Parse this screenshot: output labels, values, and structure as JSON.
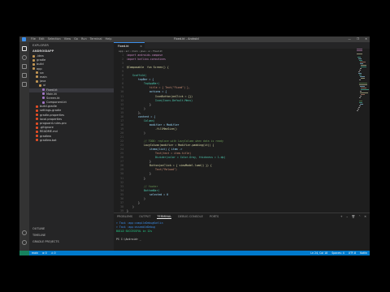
{
  "app": {
    "title": "Fixed.kt - Android",
    "menu": [
      "File",
      "Edit",
      "Selection",
      "View",
      "Go",
      "Run",
      "Terminal",
      "Help"
    ],
    "window_buttons": [
      "—",
      "❐",
      "✕"
    ]
  },
  "activity_bar": [
    "files-icon",
    "search-icon",
    "source-control-icon",
    "run-debug-icon",
    "extensions-icon",
    "account-icon",
    "settings-icon"
  ],
  "sidebar": {
    "header": "EXPLORER",
    "root": "ANDROIDAPP",
    "items": [
      {
        "label": ".idea",
        "color": "#c09553",
        "indent": 0
      },
      {
        "label": "gradle",
        "color": "#c09553",
        "indent": 0
      },
      {
        "label": "build",
        "color": "#c09553",
        "indent": 0
      },
      {
        "label": "app",
        "color": "#c09553",
        "indent": 0
      },
      {
        "label": "src",
        "color": "#c09553",
        "indent": 1
      },
      {
        "label": "main",
        "color": "#c09553",
        "indent": 1
      },
      {
        "label": "java",
        "color": "#c09553",
        "indent": 1
      },
      {
        "label": "ui",
        "color": "#c09553",
        "indent": 2
      },
      {
        "label": "Fixed.kt",
        "color": "#a074c4",
        "indent": 3,
        "selected": true
      },
      {
        "label": "Main.kt",
        "color": "#a074c4",
        "indent": 3
      },
      {
        "label": "Screen.kt",
        "color": "#a074c4",
        "indent": 3
      },
      {
        "label": "Component.kt",
        "color": "#a074c4",
        "indent": 3
      },
      {
        "label": "build.gradle",
        "color": "#e44d26",
        "indent": 1
      },
      {
        "label": "settings.gradle",
        "color": "#e44d26",
        "indent": 1
      },
      {
        "label": "gradle.properties",
        "color": "#e44d26",
        "indent": 1
      },
      {
        "label": "local.properties",
        "color": "#e44d26",
        "indent": 1
      },
      {
        "label": "proguard-rules.pro",
        "color": "#e44d26",
        "indent": 1
      },
      {
        "label": ".gitignore",
        "color": "#e44d26",
        "indent": 1
      },
      {
        "label": "README.md",
        "color": "#e44d26",
        "indent": 1
      },
      {
        "label": "gradlew",
        "color": "#e44d26",
        "indent": 1
      },
      {
        "label": "gradlew.bat",
        "color": "#e44d26",
        "indent": 1
      }
    ],
    "sections": [
      "OUTLINE",
      "TIMELINE",
      "GRADLE PROJECTS"
    ]
  },
  "editor": {
    "tab": "Fixed.kt",
    "breadcrumbs": "app › src › main › java › ui › Fixed.kt",
    "lines": [
      {
        "text": "import androidx.compose",
        "color": "#c586c0",
        "indent": 0
      },
      {
        "text": "import kotlinx.coroutines",
        "color": "#c586c0",
        "indent": 0
      },
      {
        "text": "",
        "color": "#d4d4d4",
        "indent": 0
      },
      {
        "text": "@Composable  fun Screen() {",
        "color": "#dcdcaa",
        "indent": 0
      },
      {
        "text": "",
        "color": "#d4d4d4",
        "indent": 0
      },
      {
        "text": "Scaffold(",
        "color": "#4ec9b0",
        "indent": 1
      },
      {
        "text": "topBar = {",
        "color": "#9cdcfe",
        "indent": 2
      },
      {
        "text": "TopAppBar(",
        "color": "#4ec9b0",
        "indent": 3
      },
      {
        "text": "title = { Text(\"Fixed\") },",
        "color": "#ce9178",
        "indent": 4
      },
      {
        "text": "actions = {",
        "color": "#9cdcfe",
        "indent": 4
      },
      {
        "text": "IconButton(onClick = {})",
        "color": "#dcdcaa",
        "indent": 5
      },
      {
        "text": "Icon(Icons.Default.Menu)",
        "color": "#4ec9b0",
        "indent": 5
      },
      {
        "text": "}",
        "color": "#d4d4d4",
        "indent": 4
      },
      {
        "text": ")",
        "color": "#d4d4d4",
        "indent": 3
      },
      {
        "text": "},",
        "color": "#d4d4d4",
        "indent": 2
      },
      {
        "text": "content = {",
        "color": "#9cdcfe",
        "indent": 2
      },
      {
        "text": "Column(",
        "color": "#4ec9b0",
        "indent": 3
      },
      {
        "text": "modifier = Modifier",
        "color": "#9cdcfe",
        "indent": 4
      },
      {
        "text": ".fillMaxSize()",
        "color": "#dcdcaa",
        "indent": 5
      },
      {
        "text": ")",
        "color": "#d4d4d4",
        "indent": 3
      },
      {
        "text": "",
        "color": "#d4d4d4",
        "indent": 0
      },
      {
        "text": "// TODO: replace with LazyColumn when data is ready",
        "color": "#6a9955",
        "indent": 3
      },
      {
        "text": "LazyColumn(modifier = Modifier.padding(it)) {",
        "color": "#dcdcaa",
        "indent": 3
      },
      {
        "text": "items(list) { item ->",
        "color": "#9cdcfe",
        "indent": 4
      },
      {
        "text": "Text(text = item.title)",
        "color": "#ce9178",
        "indent": 5
      },
      {
        "text": "Divider(color = Color.Gray, thickness = 1.dp)",
        "color": "#4ec9b0",
        "indent": 5
      },
      {
        "text": "}",
        "color": "#d4d4d4",
        "indent": 4
      },
      {
        "text": "Button(onClick = { viewModel.load() }) {",
        "color": "#dcdcaa",
        "indent": 4
      },
      {
        "text": "Text(\"Reload\")",
        "color": "#ce9178",
        "indent": 5
      },
      {
        "text": "}",
        "color": "#d4d4d4",
        "indent": 4
      },
      {
        "text": "}",
        "color": "#d4d4d4",
        "indent": 3
      },
      {
        "text": "",
        "color": "#d4d4d4",
        "indent": 0
      },
      {
        "text": "// footer",
        "color": "#6a9955",
        "indent": 3
      },
      {
        "text": "BottomBar(",
        "color": "#4ec9b0",
        "indent": 3
      },
      {
        "text": "selected = 0",
        "color": "#9cdcfe",
        "indent": 4
      },
      {
        "text": ")",
        "color": "#d4d4d4",
        "indent": 3
      },
      {
        "text": "}",
        "color": "#d4d4d4",
        "indent": 2
      },
      {
        "text": ")",
        "color": "#d4d4d4",
        "indent": 1
      },
      {
        "text": "}",
        "color": "#d4d4d4",
        "indent": 0
      }
    ]
  },
  "panel": {
    "tabs": [
      "PROBLEMS",
      "OUTPUT",
      "TERMINAL",
      "DEBUG CONSOLE",
      "PORTS"
    ],
    "active_tab": 2,
    "controls": [
      "+",
      "⌄",
      "🗑",
      "⌃",
      "✕"
    ],
    "terminal_lines": [
      {
        "text": "> Task :app:compileDebugKotlin",
        "color": "#3b8eea"
      },
      {
        "text": "> Task :app:assembleDebug",
        "color": "#3b8eea"
      },
      {
        "text": "BUILD SUCCESSFUL in 12s",
        "color": "#23d18b"
      },
      {
        "text": "",
        "color": "#cccccc"
      },
      {
        "text": "PS C:\\Android> _",
        "color": "#cccccc"
      }
    ]
  },
  "status_bar": {
    "left": [
      "main",
      "⊗ 0",
      "⚠ 0"
    ],
    "right": [
      "Ln 24, Col 18",
      "Spaces: 4",
      "UTF-8",
      "Kotlin"
    ]
  }
}
